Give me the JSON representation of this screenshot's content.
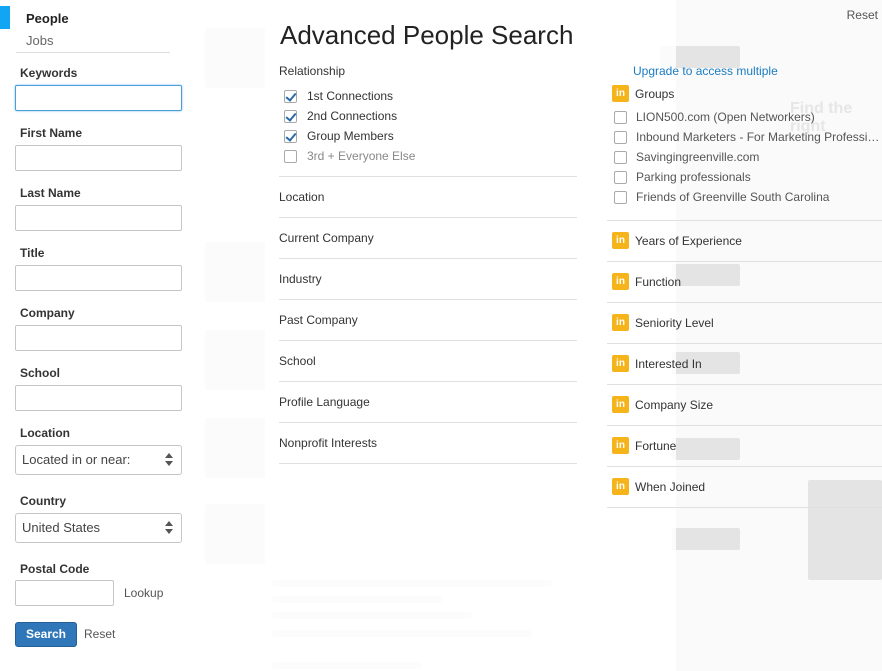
{
  "nav": {
    "people": "People",
    "jobs": "Jobs"
  },
  "form": {
    "keywords_label": "Keywords",
    "first_name_label": "First Name",
    "last_name_label": "Last Name",
    "title_label": "Title",
    "company_label": "Company",
    "school_label": "School",
    "location_label": "Location",
    "location_value": "Located in or near:",
    "country_label": "Country",
    "country_value": "United States",
    "postal_label": "Postal Code",
    "lookup_label": "Lookup",
    "search_button": "Search",
    "reset_link": "Reset"
  },
  "header": {
    "title": "Advanced People Search",
    "reset": "Reset"
  },
  "relationship": {
    "heading": "Relationship",
    "options": [
      {
        "label": "1st Connections",
        "checked": true
      },
      {
        "label": "2nd Connections",
        "checked": true
      },
      {
        "label": "Group Members",
        "checked": true
      },
      {
        "label": "3rd + Everyone Else",
        "checked": false
      }
    ]
  },
  "sections": [
    "Location",
    "Current Company",
    "Industry",
    "Past Company",
    "School",
    "Profile Language",
    "Nonprofit Interests"
  ],
  "groups": {
    "upgrade_link": "Upgrade to access multiple",
    "heading": "Groups",
    "icon_text": "in",
    "items": [
      "LION500.com (Open Networkers)",
      "Inbound Marketers - For Marketing Professi…",
      "Savingingreenville.com",
      "Parking professionals",
      "Friends of Greenville South Carolina"
    ]
  },
  "premium_filters": [
    "Years of Experience",
    "Function",
    "Seniority Level",
    "Interested In",
    "Company Size",
    "Fortune",
    "When Joined"
  ],
  "colors": {
    "accent": "#12a5f4",
    "button": "#2f77b8",
    "premium": "#f5b41a",
    "link": "#1a7cc1"
  }
}
